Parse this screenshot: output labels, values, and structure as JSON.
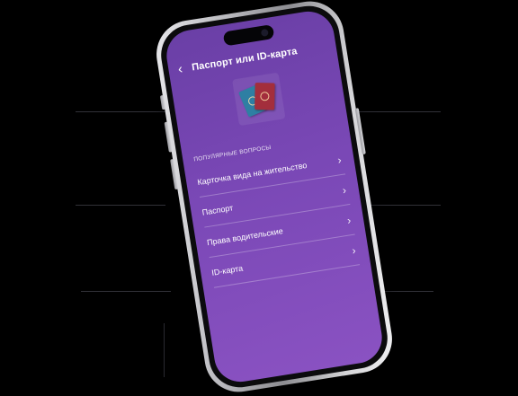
{
  "header": {
    "title": "Паспорт или ID-карта",
    "back_icon": "chevron-left-icon"
  },
  "hero": {
    "image": "passports-illustration"
  },
  "popular": {
    "section_label": "популярные вопросы",
    "items": [
      {
        "label": "Карточка вида на жительство",
        "icon": "chevron-right-icon"
      },
      {
        "label": "Паспорт",
        "icon": "chevron-right-icon"
      },
      {
        "label": "Права водительские",
        "icon": "chevron-right-icon"
      },
      {
        "label": "ID-карта",
        "icon": "chevron-right-icon"
      }
    ]
  },
  "colors": {
    "screen_background": "#7a48b6",
    "text": "#ffffff",
    "phone_frame": "#b9b9be"
  }
}
